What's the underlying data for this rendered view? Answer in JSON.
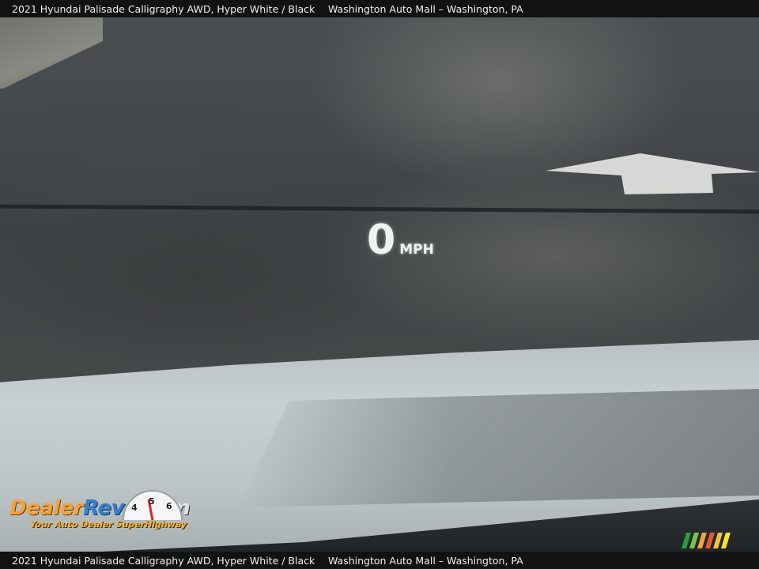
{
  "caption": {
    "vehicle": "2021 Hyundai Palisade Calligraphy AWD,  Hyper White / Black",
    "dealer": "Washington Auto Mall – Washington, PA"
  },
  "hud": {
    "speed": "0",
    "unit": "MPH"
  },
  "logo": {
    "part1": "Dealer",
    "part2": "Revs",
    "part3": ".com",
    "tagline": "Your Auto Dealer SuperHighway",
    "gauge_numbers": [
      "4",
      "5",
      "6"
    ]
  },
  "colors": {
    "caption_bg": "#111213",
    "hud_text": "#eef2f2",
    "hood": "#c9d0d1",
    "road_paint": "#d9c23c",
    "logo_orange": "#f2a33a",
    "logo_blue": "#3b7fc8"
  }
}
